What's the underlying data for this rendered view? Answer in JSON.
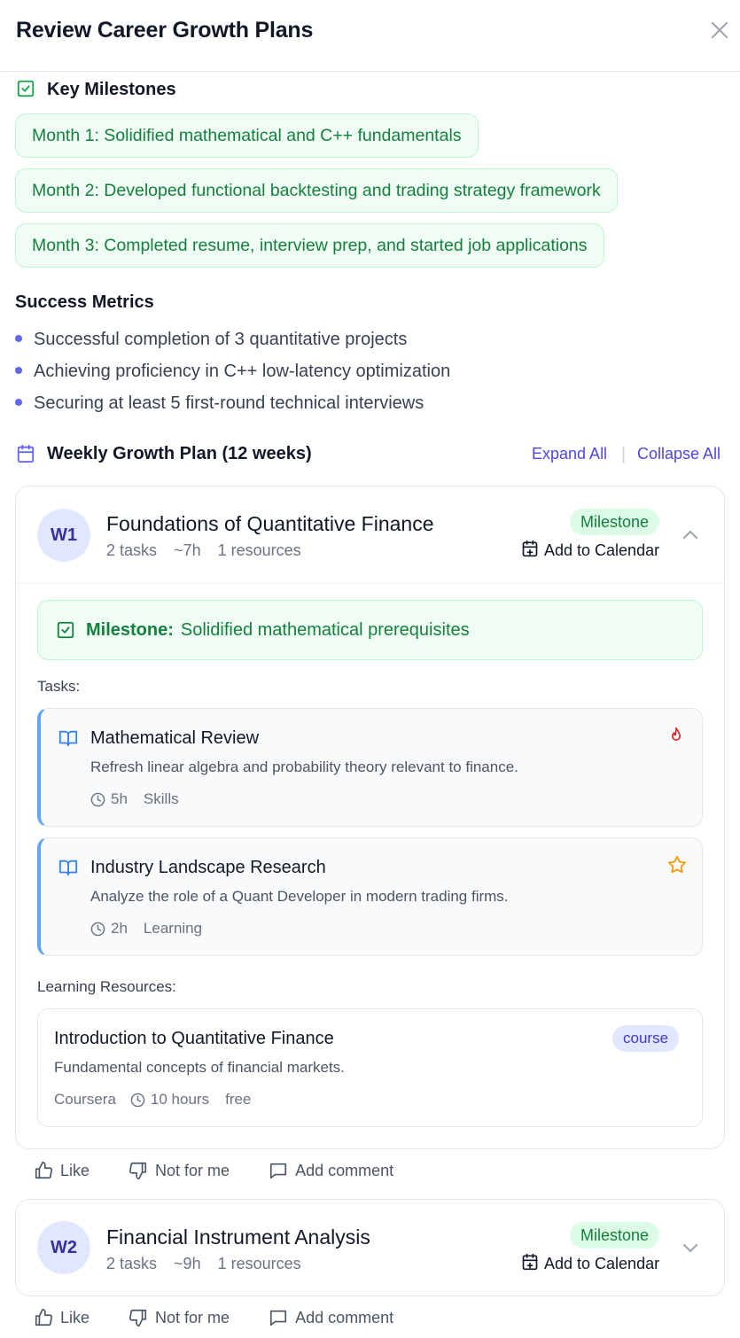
{
  "modal": {
    "title": "Review Career Growth Plans",
    "close_icon": "close-icon"
  },
  "milestones": {
    "heading": "Key Milestones",
    "items": [
      "Month 1: Solidified mathematical and C++ fundamentals",
      "Month 2: Developed functional backtesting and trading strategy framework",
      "Month 3: Completed resume, interview prep, and started job applications"
    ]
  },
  "metrics": {
    "heading": "Success Metrics",
    "items": [
      "Successful completion of 3 quantitative projects",
      "Achieving proficiency in C++ low-latency optimization",
      "Securing at least 5 first-round technical interviews"
    ]
  },
  "weekly": {
    "heading": "Weekly Growth Plan (12 weeks)",
    "expand_all": "Expand All",
    "separator": "|",
    "collapse_all": "Collapse All"
  },
  "weeks": [
    {
      "badge": "W1",
      "title": "Foundations of Quantitative Finance",
      "tasks_count": "2 tasks",
      "hours": "~7h",
      "resources_count": "1 resources",
      "milestone_badge": "Milestone",
      "calendar_label": "Add to Calendar",
      "expanded": true,
      "milestone_label": "Milestone:",
      "milestone_text": "Solidified mathematical prerequisites",
      "tasks_label": "Tasks:",
      "tasks": [
        {
          "title": "Mathematical Review",
          "description": "Refresh linear algebra and probability theory relevant to finance.",
          "duration": "5h",
          "category": "Skills",
          "priority_icon": "flame-icon"
        },
        {
          "title": "Industry Landscape Research",
          "description": "Analyze the role of a Quant Developer in modern trading firms.",
          "duration": "2h",
          "category": "Learning",
          "priority_icon": "star-icon"
        }
      ],
      "resources_label": "Learning Resources:",
      "resources": [
        {
          "title": "Introduction to Quantitative Finance",
          "description": "Fundamental concepts of financial markets.",
          "provider": "Coursera",
          "duration": "10 hours",
          "cost": "free",
          "type": "course"
        }
      ]
    },
    {
      "badge": "W2",
      "title": "Financial Instrument Analysis",
      "tasks_count": "2 tasks",
      "hours": "~9h",
      "resources_count": "1 resources",
      "milestone_badge": "Milestone",
      "calendar_label": "Add to Calendar",
      "expanded": false
    }
  ],
  "feedback": {
    "like": "Like",
    "not_for_me": "Not for me",
    "add_comment": "Add comment"
  },
  "colors": {
    "accent": "#4f46e5",
    "success": "#15803d",
    "task_border": "#60a5fa",
    "flame": "#dc2626",
    "star": "#f59e0b"
  }
}
